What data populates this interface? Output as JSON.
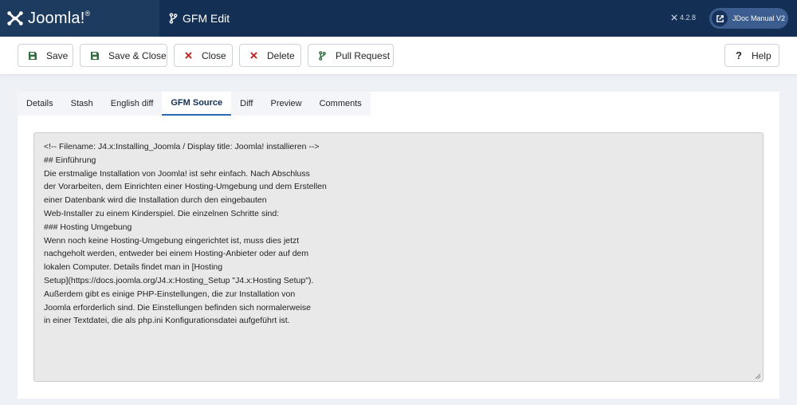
{
  "header": {
    "brand": "Joomla",
    "brand_mark": "!",
    "title": "GFM Edit",
    "version": "4.2.8",
    "site_label": "JDoc Manual V2"
  },
  "toolbar": {
    "save": "Save",
    "save_close": "Save & Close",
    "close": "Close",
    "delete": "Delete",
    "pull_request": "Pull Request",
    "help": "Help"
  },
  "tabs": [
    "Details",
    "Stash",
    "English diff",
    "GFM Source",
    "Diff",
    "Preview",
    "Comments"
  ],
  "active_tab": "GFM Source",
  "editor": {
    "lines": [
      "<!-- Filename: J4.x:Installing_Joomla / Display title: Joomla! installieren -->",
      "",
      "## Einführung",
      "",
      "Die erstmalige Installation von Joomla! ist sehr einfach. Nach Abschluss",
      "der Vorarbeiten, dem Einrichten einer Hosting-Umgebung und dem Erstellen",
      "einer Datenbank wird die Installation durch den eingebauten",
      "Web-Installer zu einem Kinderspiel. Die einzelnen Schritte sind:",
      "",
      "### Hosting Umgebung",
      "",
      "Wenn noch keine Hosting-Umgebung eingerichtet ist, muss dies jetzt",
      "nachgeholt werden, entweder bei einem Hosting-Anbieter oder auf dem",
      "lokalen Computer. Details findet man in [Hosting",
      "Setup](https://docs.joomla.org/J4.x:Hosting_Setup \"J4.x:Hosting Setup\").",
      "",
      "Außerdem gibt es einige PHP-Einstellungen, die zur Installation von",
      "Joomla erforderlich sind. Die Einstellungen befinden sich normalerweise",
      "in einer Textdatei, die als php.ini Konfigurationsdatei aufgeführt ist."
    ]
  },
  "colors": {
    "header_bg": "#132f53",
    "logo_bg": "#1d3a5f",
    "accent": "#2a69b8",
    "danger": "#c52827",
    "success": "#2f6f3e"
  }
}
